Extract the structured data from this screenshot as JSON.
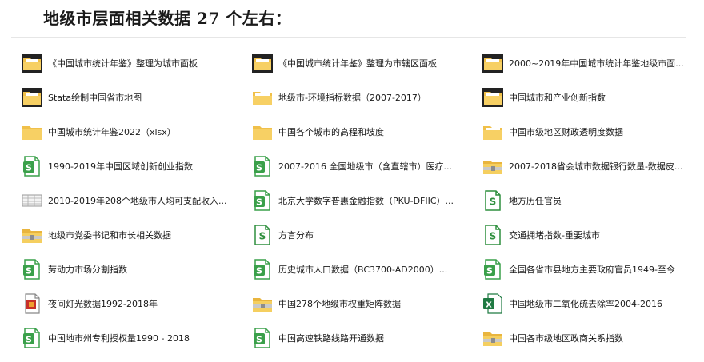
{
  "page": {
    "title": "地级市层面相关数据 27 个左右："
  },
  "files": [
    {
      "name": "《中国城市统计年鉴》整理为城市面板",
      "icon": "folder-dark-icon"
    },
    {
      "name": "《中国城市统计年鉴》整理为市辖区面板",
      "icon": "folder-dark-icon"
    },
    {
      "name": "2000~2019年中国城市统计年鉴地级市面...",
      "icon": "folder-dark-icon"
    },
    {
      "name": "Stata绘制中国省市地图",
      "icon": "folder-dark-icon"
    },
    {
      "name": "地级市-环境指标数据（2007-2017）",
      "icon": "folder-light-icon"
    },
    {
      "name": "中国城市和产业创新指数",
      "icon": "folder-dark-icon"
    },
    {
      "name": "中国城市统计年鉴2022（xlsx）",
      "icon": "folder-icon"
    },
    {
      "name": "中国各个城市的高程和坡度",
      "icon": "folder-icon"
    },
    {
      "name": "中国市级地区财政透明度数据",
      "icon": "folder-light-icon"
    },
    {
      "name": "1990-2019年中国区域创新创业指数",
      "icon": "sheet-file-icon"
    },
    {
      "name": "2007-2016 全国地级市（含直辖市）医疗...",
      "icon": "sheet-file-icon"
    },
    {
      "name": "2007-2018省会城市数据银行数量-数据皮...",
      "icon": "folder-zip-icon"
    },
    {
      "name": "2010-2019年208个地级市人均可支配收入...",
      "icon": "table-image-icon"
    },
    {
      "name": "北京大学数字普惠金融指数（PKU-DFIIC）...",
      "icon": "sheet-file-icon"
    },
    {
      "name": "地方历任官员",
      "icon": "sheet-file-outline-icon"
    },
    {
      "name": "地级市党委书记和市长相关数据",
      "icon": "folder-zip-icon"
    },
    {
      "name": "方言分布",
      "icon": "sheet-file-outline-icon"
    },
    {
      "name": "交通拥堵指数-重要城市",
      "icon": "sheet-file-outline-icon"
    },
    {
      "name": "劳动力市场分割指数",
      "icon": "sheet-file-icon"
    },
    {
      "name": "历史城市人口数据（BC3700-AD2000）...",
      "icon": "sheet-file-icon"
    },
    {
      "name": "全国各省市县地方主要政府官员1949-至今",
      "icon": "sheet-file-icon"
    },
    {
      "name": "夜间灯光数据1992-2018年",
      "icon": "archive-file-icon"
    },
    {
      "name": "中国278个地级市权重矩阵数据",
      "icon": "folder-zip-icon"
    },
    {
      "name": "中国地级市二氧化硫去除率2004-2016",
      "icon": "excel-file-icon"
    },
    {
      "name": "中国地市州专利授权量1990 - 2018",
      "icon": "sheet-file-icon"
    },
    {
      "name": "中国高速铁路线路开通数据",
      "icon": "sheet-file-icon"
    },
    {
      "name": "中国各市级地区政商关系指数",
      "icon": "folder-zip-icon"
    }
  ]
}
